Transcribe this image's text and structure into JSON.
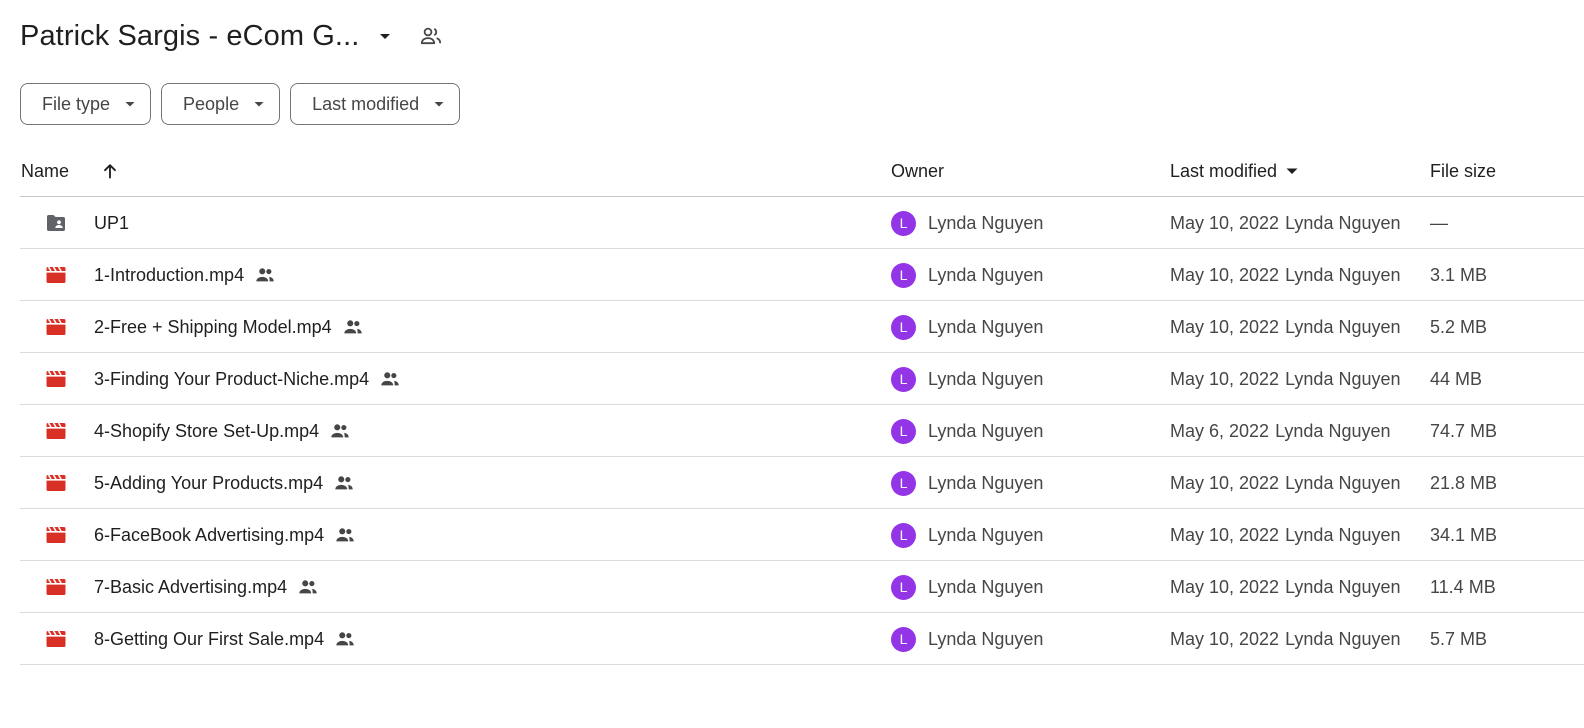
{
  "header": {
    "folder_title": "Patrick Sargis - eCom G...",
    "dropdown_icon": "arrow-drop-down-icon",
    "shared_icon": "shared-people-icon"
  },
  "filters": [
    {
      "label": "File type"
    },
    {
      "label": "People"
    },
    {
      "label": "Last modified"
    }
  ],
  "columns": {
    "name": "Name",
    "owner": "Owner",
    "last_modified": "Last modified",
    "file_size": "File size"
  },
  "files": [
    {
      "name": "UP1",
      "type": "shared-folder",
      "shared": false,
      "owner_initial": "L",
      "owner": "Lynda Nguyen",
      "modified_date": "May 10, 2022",
      "modified_by": "Lynda Nguyen",
      "size": "—"
    },
    {
      "name": "1-Introduction.mp4",
      "type": "video",
      "shared": true,
      "owner_initial": "L",
      "owner": "Lynda Nguyen",
      "modified_date": "May 10, 2022",
      "modified_by": "Lynda Nguyen",
      "size": "3.1 MB"
    },
    {
      "name": "2-Free + Shipping Model.mp4",
      "type": "video",
      "shared": true,
      "owner_initial": "L",
      "owner": "Lynda Nguyen",
      "modified_date": "May 10, 2022",
      "modified_by": "Lynda Nguyen",
      "size": "5.2 MB"
    },
    {
      "name": "3-Finding Your Product-Niche.mp4",
      "type": "video",
      "shared": true,
      "owner_initial": "L",
      "owner": "Lynda Nguyen",
      "modified_date": "May 10, 2022",
      "modified_by": "Lynda Nguyen",
      "size": "44 MB"
    },
    {
      "name": "4-Shopify Store Set-Up.mp4",
      "type": "video",
      "shared": true,
      "owner_initial": "L",
      "owner": "Lynda Nguyen",
      "modified_date": "May 6, 2022",
      "modified_by": "Lynda Nguyen",
      "size": "74.7 MB"
    },
    {
      "name": "5-Adding Your Products.mp4",
      "type": "video",
      "shared": true,
      "owner_initial": "L",
      "owner": "Lynda Nguyen",
      "modified_date": "May 10, 2022",
      "modified_by": "Lynda Nguyen",
      "size": "21.8 MB"
    },
    {
      "name": "6-FaceBook Advertising.mp4",
      "type": "video",
      "shared": true,
      "owner_initial": "L",
      "owner": "Lynda Nguyen",
      "modified_date": "May 10, 2022",
      "modified_by": "Lynda Nguyen",
      "size": "34.1 MB"
    },
    {
      "name": "7-Basic Advertising.mp4",
      "type": "video",
      "shared": true,
      "owner_initial": "L",
      "owner": "Lynda Nguyen",
      "modified_date": "May 10, 2022",
      "modified_by": "Lynda Nguyen",
      "size": "11.4 MB"
    },
    {
      "name": "8-Getting Our First Sale.mp4",
      "type": "video",
      "shared": true,
      "owner_initial": "L",
      "owner": "Lynda Nguyen",
      "modified_date": "May 10, 2022",
      "modified_by": "Lynda Nguyen",
      "size": "5.7 MB"
    }
  ],
  "colors": {
    "video_icon": "#d93025",
    "folder_icon": "#5f6368",
    "avatar": "#9334e6",
    "divider": "#dadce0"
  }
}
